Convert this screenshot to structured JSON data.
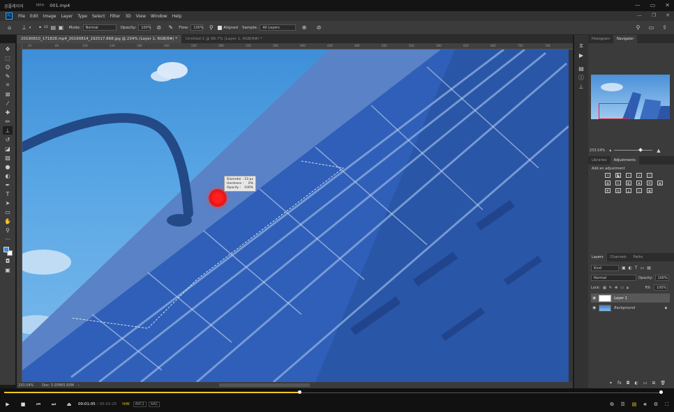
{
  "player": {
    "app_name": "곰플레이어",
    "format_label": "MP4",
    "file_name": "001.mp4",
    "window_min": "—",
    "window_max": "▭",
    "window_close": "✕"
  },
  "photoshop": {
    "logo": "Ps",
    "menu": [
      "File",
      "Edit",
      "Image",
      "Layer",
      "Type",
      "Select",
      "Filter",
      "3D",
      "View",
      "Window",
      "Help"
    ],
    "options": {
      "mode_label": "Mode:",
      "mode_value": "Normal",
      "opacity_label": "Opacity:",
      "opacity_value": "100%",
      "flow_label": "Flow:",
      "flow_value": "100%",
      "aligned_label": "Aligned",
      "sample_label": "Sample:",
      "sample_value": "All Layers",
      "brush_size": "23"
    },
    "tabs": [
      {
        "label": "20190810_171828.mp4_20190814_192517.868.jpg @ 234% (Layer 1, RGB/8#) *"
      },
      {
        "label": "Untitled-1 @ 66.7% (Layer 1, RGB/8#) *"
      }
    ],
    "ruler_ticks": [
      "20",
      "60",
      "100",
      "140",
      "180",
      "200",
      "240",
      "280",
      "320",
      "360",
      "400",
      "440",
      "480",
      "500",
      "540",
      "580",
      "620",
      "660",
      "700",
      "740"
    ],
    "brush_tooltip": {
      "diameter_label": "Diameter :",
      "diameter_value": "23 px",
      "hardness_label": "Hardness :",
      "hardness_value": "0%",
      "opacity_label": "Opacity :",
      "opacity_value": "100%"
    },
    "status": {
      "zoom": "233.54%",
      "doc": "Doc: 5.93M/5.93M"
    },
    "panels": {
      "top_tabs": [
        "Histogram",
        "Navigator"
      ],
      "nav_zoom": "233.54%",
      "mid_tabs": [
        "Libraries",
        "Adjustments"
      ],
      "add_adjustment": "Add an adjustment",
      "layer_tabs": [
        "Layers",
        "Channels",
        "Paths"
      ],
      "kind_label": "Kind",
      "blend_mode": "Normal",
      "opacity_label": "Opacity:",
      "opacity_value": "100%",
      "lock_label": "Lock:",
      "fill_label": "Fill:",
      "fill_value": "100%",
      "layers": [
        {
          "name": "Layer 1",
          "selected": true
        },
        {
          "name": "Background",
          "selected": false
        }
      ]
    }
  },
  "playback": {
    "current_time": "00:01:05",
    "separator": "/",
    "total_time": "00:02:25",
    "hw_label": "H/W",
    "video_codec": "AVC1",
    "audio_codec": "AAC",
    "progress": 0.45,
    "volume": 1.0
  }
}
